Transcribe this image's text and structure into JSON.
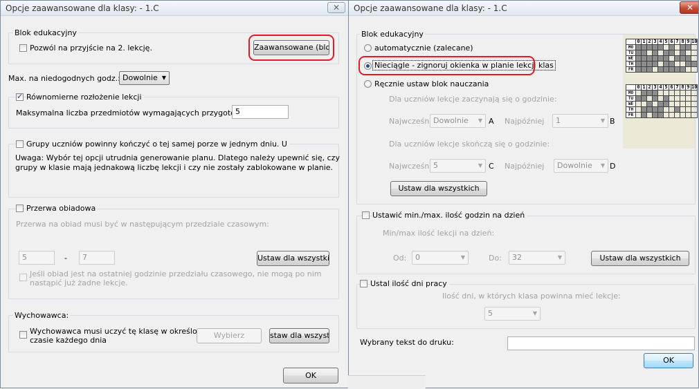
{
  "left": {
    "title": "Opcje zaawansowane dla klasy: - 1.C",
    "close_glyph": "✕",
    "blok": {
      "legend": "Blok edukacyjny",
      "allow_second_label": "Pozwól na przyjście na 2. lekcję.",
      "advanced_button": "Zaawansowane (bloki)"
    },
    "max_label": "Max. na niedogodnych godz.:",
    "max_value": "Dowolnie",
    "even": {
      "label": "Równomierne rozłożenie lekcji",
      "max_label": "Maksymalna liczba przedmiotów wymagających przygotowania",
      "max_value": "5"
    },
    "groups": {
      "label": "Grupy uczniów powinny kończyć o tej samej porze w jednym dniu. U",
      "note_line1": "Uwaga: Wybór tej opcji utrudnia generowanie planu. Dlatego należy upewnić się, czy",
      "note_line2": "grupy w klasie mają jednakową liczbę lekcji i czy nie zostały zablokowane w planie."
    },
    "lunch": {
      "label": "Przerwa obiadowa",
      "desc": "Przerwa na obiad musi być w następującym przedziale czasowym:",
      "from": "5",
      "dash": "-",
      "to": "7",
      "set_all": "Ustaw dla wszystkich",
      "last_line1": "Jeśli obiad jest na ostatniej godzinie przedziału czasowego, nie mogą po nim",
      "last_line2": "nastąpić już żadne lekcje."
    },
    "teacher": {
      "legend": "Wychowawca:",
      "line1": "Wychowawca musi uczyć tę klasę w określonym",
      "line2": "czasie każdego dnia",
      "choose": "Wybierz",
      "set_all": "staw dla wszystkich"
    },
    "ok": "OK"
  },
  "right": {
    "title": "Opcje zaawansowane dla klasy: - 1.C",
    "close_glyph": "✕",
    "blok": {
      "legend": "Blok edukacyjny",
      "opt_auto": "automatycznie (zalecane)",
      "opt_cont": "Nieciągle - zignoruj okienka w planie lekcji klas",
      "opt_manual": "Ręcznie ustaw blok nauczania",
      "start_label": "Dla uczniów lekcje zaczynają się o godzinie:",
      "earliest1": "Najwcześniej",
      "earliest1_value": "Dowolnie",
      "a": "A",
      "latest1": "Najpóźniej",
      "latest1_value": "1",
      "b": "B",
      "end_label": "Dla uczniów lekcje skończą się o godzinie:",
      "earliest2": "Najwcześniej",
      "earliest2_value": "5",
      "c": "C",
      "latest2": "Najpóźniej",
      "latest2_value": "Dowolnie",
      "d": "D",
      "set_all": "Ustaw dla wszystkich"
    },
    "minmax": {
      "label": "Ustawić min./max. ilość godzin na dzień",
      "sub": "Min/max ilość lekcji na dzień:",
      "from_label": "Od:",
      "from_value": "0",
      "to_label": "Do:",
      "to_value": "32",
      "set_all": "Ustaw dla wszystkich"
    },
    "days": {
      "label": "Ustal ilość dni pracy",
      "sub": "Ilość dni, w których klasa powinna mieć lekcje:",
      "value": "5"
    },
    "print_label": "Wybrany tekst do druku:",
    "print_value": "",
    "ok": "OK",
    "grid": {
      "cols": [
        "0",
        "1",
        "2",
        "3",
        "4",
        "5",
        "6",
        "7",
        "8",
        "9",
        "10"
      ],
      "days": [
        "MO",
        "TU",
        "WE",
        "TH",
        "FR"
      ],
      "top": [
        [
          1,
          1,
          1,
          1,
          1,
          0,
          1,
          0,
          1,
          1,
          0
        ],
        [
          1,
          1,
          0,
          1,
          0,
          1,
          1,
          0,
          1,
          0,
          0
        ],
        [
          1,
          1,
          1,
          1,
          1,
          1,
          0,
          1,
          1,
          1,
          0
        ],
        [
          1,
          1,
          1,
          1,
          0,
          1,
          1,
          0,
          0,
          1,
          1
        ],
        [
          1,
          1,
          1,
          0,
          1,
          1,
          1,
          1,
          1,
          0,
          0
        ]
      ],
      "bottom": [
        [
          0,
          1,
          1,
          1,
          0,
          0,
          0,
          0,
          0,
          0,
          0
        ],
        [
          1,
          1,
          0,
          1,
          0,
          1,
          0,
          0,
          0,
          0,
          0
        ],
        [
          0,
          0,
          1,
          0,
          1,
          1,
          0,
          0,
          0,
          0,
          0
        ],
        [
          0,
          1,
          1,
          1,
          1,
          0,
          0,
          1,
          0,
          0,
          0
        ],
        [
          0,
          1,
          0,
          1,
          1,
          0,
          0,
          0,
          0,
          0,
          0
        ]
      ]
    }
  }
}
